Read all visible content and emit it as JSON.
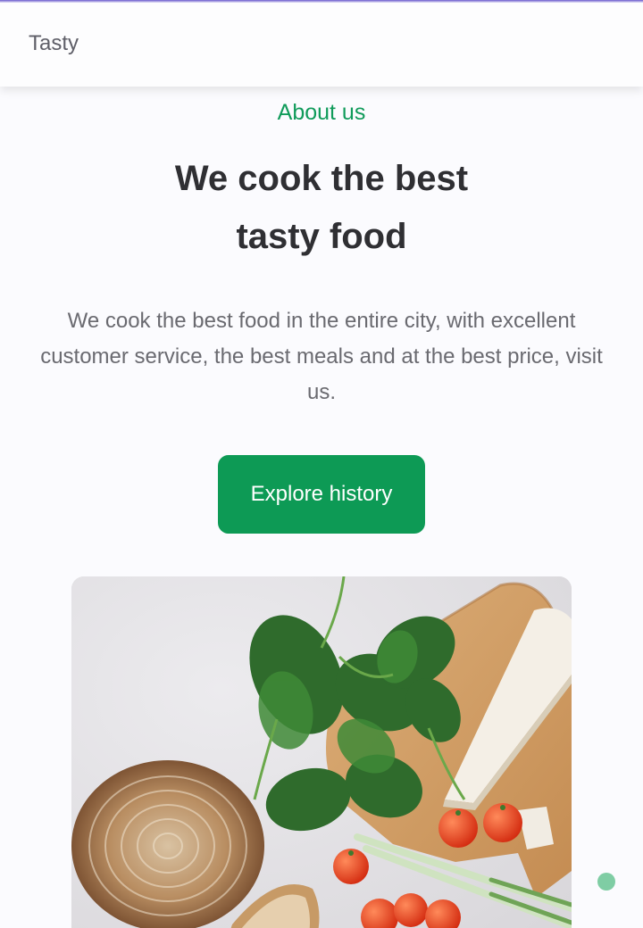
{
  "header": {
    "brand": "Tasty"
  },
  "about": {
    "section_label": "About us",
    "title_line1": "We cook the best",
    "title_line2": "tasty food",
    "description": "We cook the best food in the entire city, with excellent customer service, the best meals and at the best price, visit us.",
    "cta_label": "Explore history"
  },
  "colors": {
    "accent": "#0d9a55",
    "accent_text": "#109b5a",
    "heading": "#2f2f33",
    "body_text": "#6a6a70",
    "background": "#fbfbfe"
  },
  "icons": {
    "scroll_indicator": "dot-indicator-icon"
  }
}
